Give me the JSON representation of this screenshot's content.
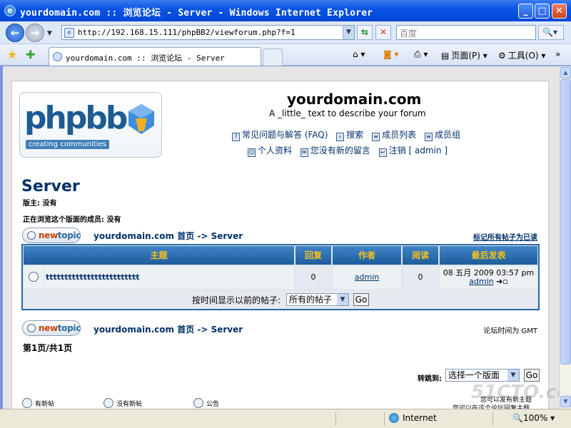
{
  "window": {
    "title": "yourdomain.com :: 浏览论坛 - Server - Windows Internet Explorer"
  },
  "address": {
    "url": "http://192.168.15.111/phpBB2/viewforum.php?f=1",
    "search_placeholder": "百度"
  },
  "tab": {
    "label": "yourdomain.com :: 浏览论坛 - Server"
  },
  "commands": {
    "page": "页面(P)",
    "tools": "工具(O)"
  },
  "header": {
    "logo_text": "phpbb",
    "logo_tagline": "creating communities",
    "site_name": "yourdomain.com",
    "site_desc": "A _little_ text to describe your forum",
    "links_row1": [
      "常见问题与解答 (FAQ)",
      "搜索",
      "成员列表",
      "成员组"
    ],
    "links_row2": [
      "个人资料",
      "您没有新的留言",
      "注销 [ admin ]"
    ]
  },
  "forum": {
    "title": "Server",
    "moderator": "版主: 没有",
    "browsing": "正在浏览这个版面的成员: 没有",
    "newtopic_new": "new",
    "newtopic_topic": "topic",
    "breadcrumb": "yourdomain.com 首页  -> Server",
    "mark_read": "标记所有帖子为已读",
    "timezone": "论坛时间为 GMT",
    "pagination": "第1页/共1页",
    "jump_label": "转跳到:",
    "jump_select": "选择一个版面",
    "go": "Go",
    "show_from_label": "按时间显示以前的帖子:",
    "show_from_select": "所有的帖子",
    "legend": [
      "有新帖",
      "没有新帖",
      "公告"
    ],
    "legend_right": [
      "您可以发布新主题",
      "您可以在这个论坛回复主题"
    ]
  },
  "table": {
    "headers": [
      "主题",
      "回复",
      "作者",
      "阅读",
      "最后发表"
    ],
    "row": {
      "topic": "ttttttttttttttttttttttttt",
      "replies": "0",
      "author": "admin",
      "views": "0",
      "last_post_date": "08 五月 2009 03:57 pm",
      "last_post_author": "admin"
    }
  },
  "status": {
    "zone": "Internet",
    "zoom": "100%"
  },
  "watermark": "51CTO.com"
}
